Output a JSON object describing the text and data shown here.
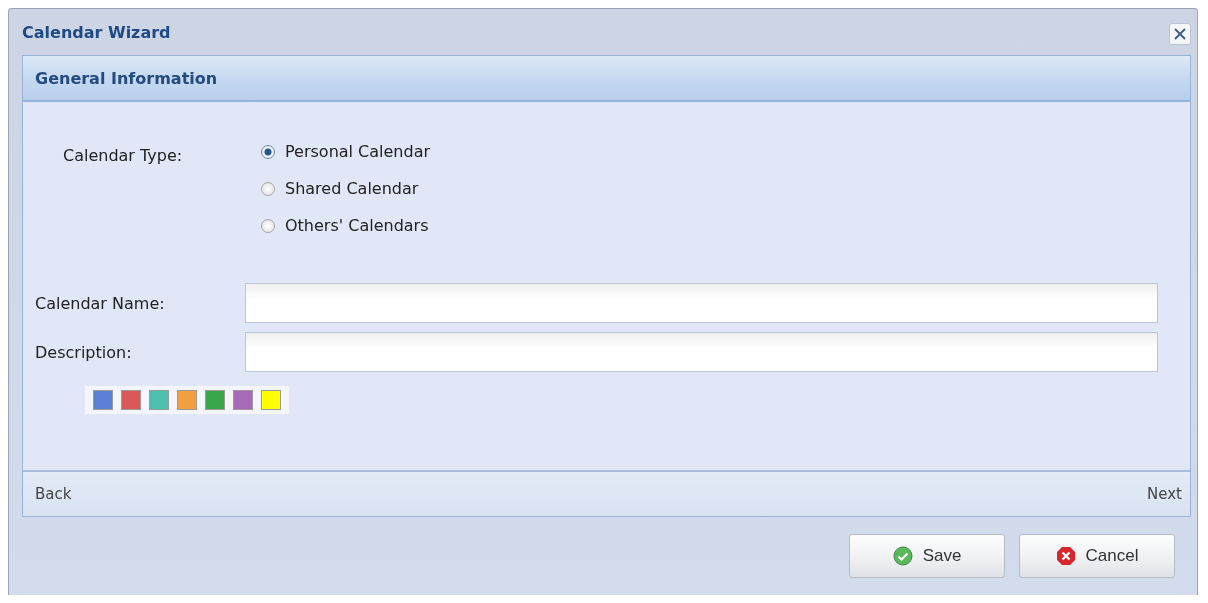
{
  "window": {
    "title": "Calendar Wizard"
  },
  "panel": {
    "title": "General Information"
  },
  "calendar_type": {
    "label": "Calendar Type:",
    "options": [
      {
        "label": "Personal Calendar",
        "selected": true
      },
      {
        "label": "Shared Calendar",
        "selected": false
      },
      {
        "label": "Others' Calendars",
        "selected": false
      }
    ]
  },
  "fields": [
    {
      "label": "Calendar Name:"
    },
    {
      "label": "Description:"
    }
  ],
  "colors": [
    {
      "color": "#5b7fd4"
    },
    {
      "color": "#d9595b"
    },
    {
      "color": "#4dbfae"
    },
    {
      "color": "#f0a040"
    },
    {
      "color": "#3aa64a"
    },
    {
      "color": "#a86ab8"
    },
    {
      "color": "#ffff00"
    }
  ],
  "nav": {
    "back": "Back",
    "next": "Next"
  },
  "buttons": [
    {
      "kind": "save",
      "label": "Save"
    },
    {
      "kind": "cancel",
      "label": "Cancel"
    }
  ]
}
